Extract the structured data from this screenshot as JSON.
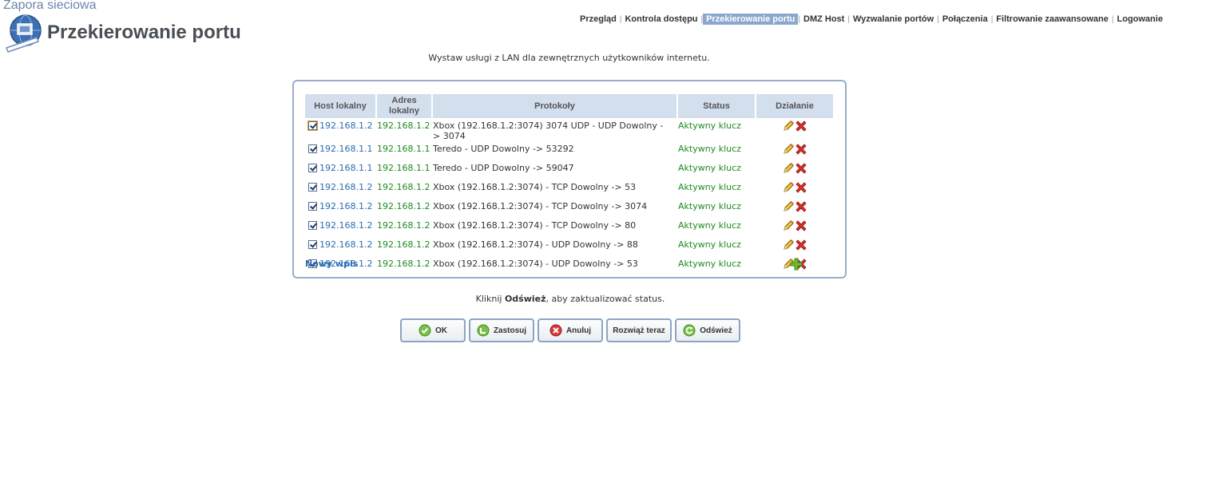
{
  "header": {
    "app_title": "Zapora sieciowa",
    "page_title": "Przekierowanie portu",
    "logo_icon": "firewall-globe-icon"
  },
  "nav": {
    "items": [
      {
        "label": "Przegląd",
        "active": false
      },
      {
        "label": "Kontrola dostępu",
        "active": false
      },
      {
        "label": "Przekierowanie portu",
        "active": true
      },
      {
        "label": "DMZ Host",
        "active": false
      },
      {
        "label": "Wyzwalanie portów",
        "active": false
      },
      {
        "label": "Połączenia",
        "active": false
      },
      {
        "label": "Filtrowanie zaawansowane",
        "active": false
      },
      {
        "label": "Logowanie",
        "active": false
      }
    ]
  },
  "description": "Wystaw usługi z LAN dla zewnętrznych użytkowników internetu.",
  "table": {
    "headers": {
      "host": "Host lokalny",
      "address_line1": "Adres",
      "address_line2": "lokalny",
      "protocols": "Protokoły",
      "status": "Status",
      "action": "Działanie"
    },
    "rows": [
      {
        "checked": true,
        "host": "192.168.1.2",
        "address": "192.168.1.2",
        "protocol_line1": "Xbox (192.168.1.2:3074) 3074 UDP - UDP Dowolny -",
        "protocol_line2": "> 3074",
        "status": "Aktywny klucz"
      },
      {
        "checked": true,
        "host": "192.168.1.1",
        "address": "192.168.1.1",
        "protocol_line1": "Teredo - UDP Dowolny -> 53292",
        "protocol_line2": "",
        "status": "Aktywny klucz"
      },
      {
        "checked": true,
        "host": "192.168.1.1",
        "address": "192.168.1.1",
        "protocol_line1": "Teredo - UDP Dowolny -> 59047",
        "protocol_line2": "",
        "status": "Aktywny klucz"
      },
      {
        "checked": true,
        "host": "192.168.1.2",
        "address": "192.168.1.2",
        "protocol_line1": "Xbox (192.168.1.2:3074) - TCP Dowolny -> 53",
        "protocol_line2": "",
        "status": "Aktywny klucz"
      },
      {
        "checked": true,
        "host": "192.168.1.2",
        "address": "192.168.1.2",
        "protocol_line1": "Xbox (192.168.1.2:3074) - TCP Dowolny -> 3074",
        "protocol_line2": "",
        "status": "Aktywny klucz"
      },
      {
        "checked": true,
        "host": "192.168.1.2",
        "address": "192.168.1.2",
        "protocol_line1": "Xbox (192.168.1.2:3074) - TCP Dowolny -> 80",
        "protocol_line2": "",
        "status": "Aktywny klucz"
      },
      {
        "checked": true,
        "host": "192.168.1.2",
        "address": "192.168.1.2",
        "protocol_line1": "Xbox (192.168.1.2:3074) - UDP Dowolny -> 88",
        "protocol_line2": "",
        "status": "Aktywny klucz"
      },
      {
        "checked": true,
        "host": "192.168.1.2",
        "address": "192.168.1.2",
        "protocol_line1": "Xbox (192.168.1.2:3074) - UDP Dowolny -> 53",
        "protocol_line2": "",
        "status": "Aktywny klucz"
      }
    ],
    "new_entry": "Nowy wpis",
    "action_icons": [
      "pencil-edit-icon",
      "red-x-delete-icon"
    ],
    "add_icon": "green-plus-add-icon"
  },
  "hint": {
    "before": "Kliknij ",
    "bold": "Odśwież",
    "after": ", aby zaktualizować status."
  },
  "buttons": {
    "ok": "OK",
    "apply": "Zastosuj",
    "cancel": "Anuluj",
    "resolve": "Rozwiąż teraz",
    "refresh": "Odśwież"
  },
  "colors": {
    "nav_active_bg": "#8aa7cd",
    "panel_border": "#98aec9",
    "header_bg": "#d4dfee",
    "link": "#2a6cb0",
    "status_green": "#1f8a1f"
  }
}
